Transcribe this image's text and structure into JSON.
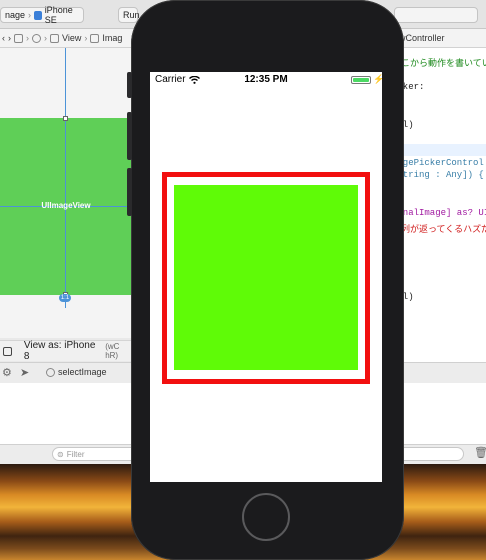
{
  "toolbar": {
    "breadcrumb_image": "nage",
    "device": "iPhone SE",
    "run_status": "Run"
  },
  "jumpbar": {
    "items": [
      "View",
      "Imag"
    ],
    "right_item": "iewController"
  },
  "canvas": {
    "image_view_label": "UIImageView",
    "size_badge": "1:1"
  },
  "view_as": {
    "label": "View as: iPhone 8",
    "size_class": "(wC hR)"
  },
  "debug": {
    "select_label": "selectImage"
  },
  "filter": {
    "placeholder": "Filter"
  },
  "code": {
    "lines": [
      {
        "text": "ここから動作を書いてい",
        "color": "#1e8a1e"
      },
      {
        "text": "icker:",
        "color": "#222"
      },
      {
        "text": "nil)",
        "color": "#222"
      },
      {
        "text": "magePickerControl",
        "color": "#3a7fa8"
      },
      {
        "text": "[String : Any]) {",
        "color": "#3a7fa8"
      },
      {
        "text": "ginalImage] as? UI",
        "color": "#a11aa1"
      },
      {
        "text": "配列が返ってくるハズだ",
        "color": "#d01a1a"
      },
      {
        "text": "nil)",
        "color": "#222"
      }
    ]
  },
  "phone": {
    "carrier": "Carrier",
    "time": "12:35 PM",
    "battery_level": 1.0
  },
  "colors": {
    "frame_red": "#f20f0f",
    "image_green": "#5ffb07",
    "canvas_green": "#5fcf57",
    "guide_blue": "#4c93d8"
  }
}
